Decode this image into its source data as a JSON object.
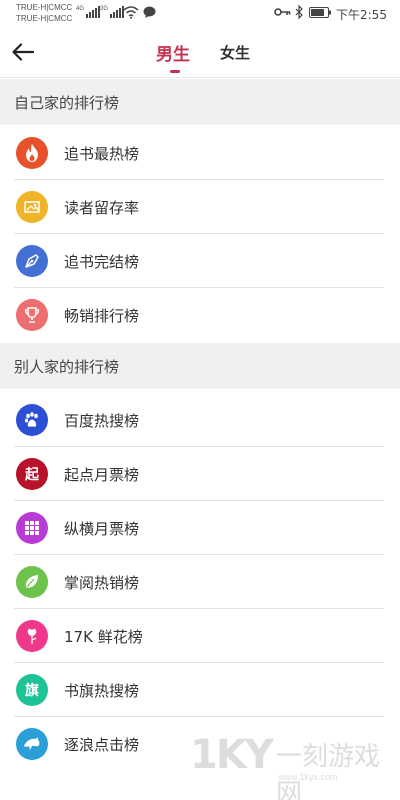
{
  "status_bar": {
    "carrier_1": "TRUE-H|CMCC",
    "carrier_2": "TRUE-H|CMCC",
    "signal_1_tag": "4G",
    "signal_2_tag": "3G",
    "time": "下午2:55",
    "icons": [
      "signal-icon",
      "wifi-icon",
      "message-icon",
      "key-icon",
      "bluetooth-icon",
      "battery-icon"
    ]
  },
  "header": {
    "back_icon": "arrow-left-icon",
    "tabs": [
      {
        "label": "男生",
        "selected": true
      },
      {
        "label": "女生",
        "selected": false
      }
    ],
    "accent_color": "#c4334e"
  },
  "sections": [
    {
      "title": "自己家的排行榜",
      "items": [
        {
          "label": "追书最热榜",
          "icon": "flame-icon",
          "color": "#e8522b"
        },
        {
          "label": "读者留存率",
          "icon": "picture-frame-icon",
          "color": "#f0b429"
        },
        {
          "label": "追书完结榜",
          "icon": "pen-nib-icon",
          "color": "#4470d6"
        },
        {
          "label": "畅销排行榜",
          "icon": "trophy-icon",
          "color": "#ee6f6f"
        }
      ]
    },
    {
      "title": "别人家的排行榜",
      "items": [
        {
          "label": "百度热搜榜",
          "icon": "paw-icon",
          "color": "#2c4fd4"
        },
        {
          "label": "起点月票榜",
          "icon": "qi-character-icon",
          "icon_text": "起",
          "color": "#b8122b"
        },
        {
          "label": "纵横月票榜",
          "icon": "grid-icon",
          "color": "#b83bd6"
        },
        {
          "label": "掌阅热销榜",
          "icon": "leaf-icon",
          "color": "#6cc24a"
        },
        {
          "label": "17K 鲜花榜",
          "icon": "rose-icon",
          "color": "#f0388a"
        },
        {
          "label": "书旗热搜榜",
          "icon": "qi-flag-character-icon",
          "icon_text": "旗",
          "color": "#1fc296"
        },
        {
          "label": "逐浪点击榜",
          "icon": "dolphin-icon",
          "color": "#2a9fd8"
        }
      ]
    }
  ],
  "watermark": {
    "brand": "1KY",
    "cn_text": "一刻游戏网",
    "url": "www.1kyx.com"
  }
}
